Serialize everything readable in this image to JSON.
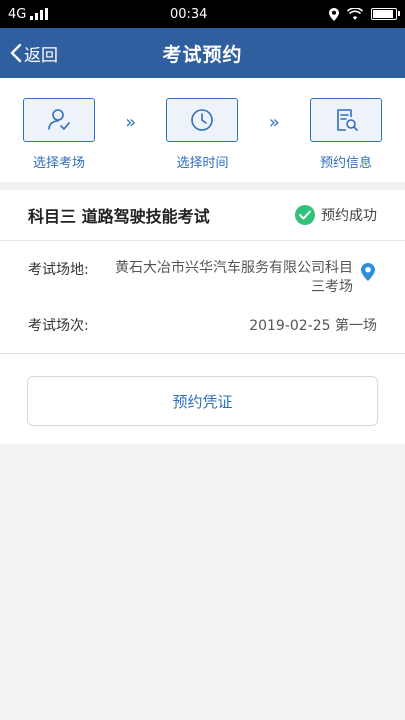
{
  "status_bar": {
    "network": "4G",
    "time": "00:34",
    "battery_level": 0.85
  },
  "navbar": {
    "back_label": "返回",
    "title": "考试预约"
  },
  "steps": [
    {
      "label": "选择考场",
      "icon": "user-check-icon"
    },
    {
      "label": "选择时间",
      "icon": "clock-icon"
    },
    {
      "label": "预约信息",
      "icon": "document-search-icon"
    }
  ],
  "step_arrow": "»",
  "exam": {
    "title": "科目三 道路驾驶技能考试",
    "status": "预约成功",
    "venue_label": "考试场地:",
    "venue_value": "黄石大冶市兴华汽车服务有限公司科目三考场",
    "session_label": "考试场次:",
    "session_value": "2019-02-25 第一场"
  },
  "voucher_button": "预约凭证",
  "colors": {
    "nav_bg": "#2f5f9e",
    "accent": "#2f6fbf",
    "success": "#30c27a",
    "page_bg": "#f2f2f2"
  }
}
